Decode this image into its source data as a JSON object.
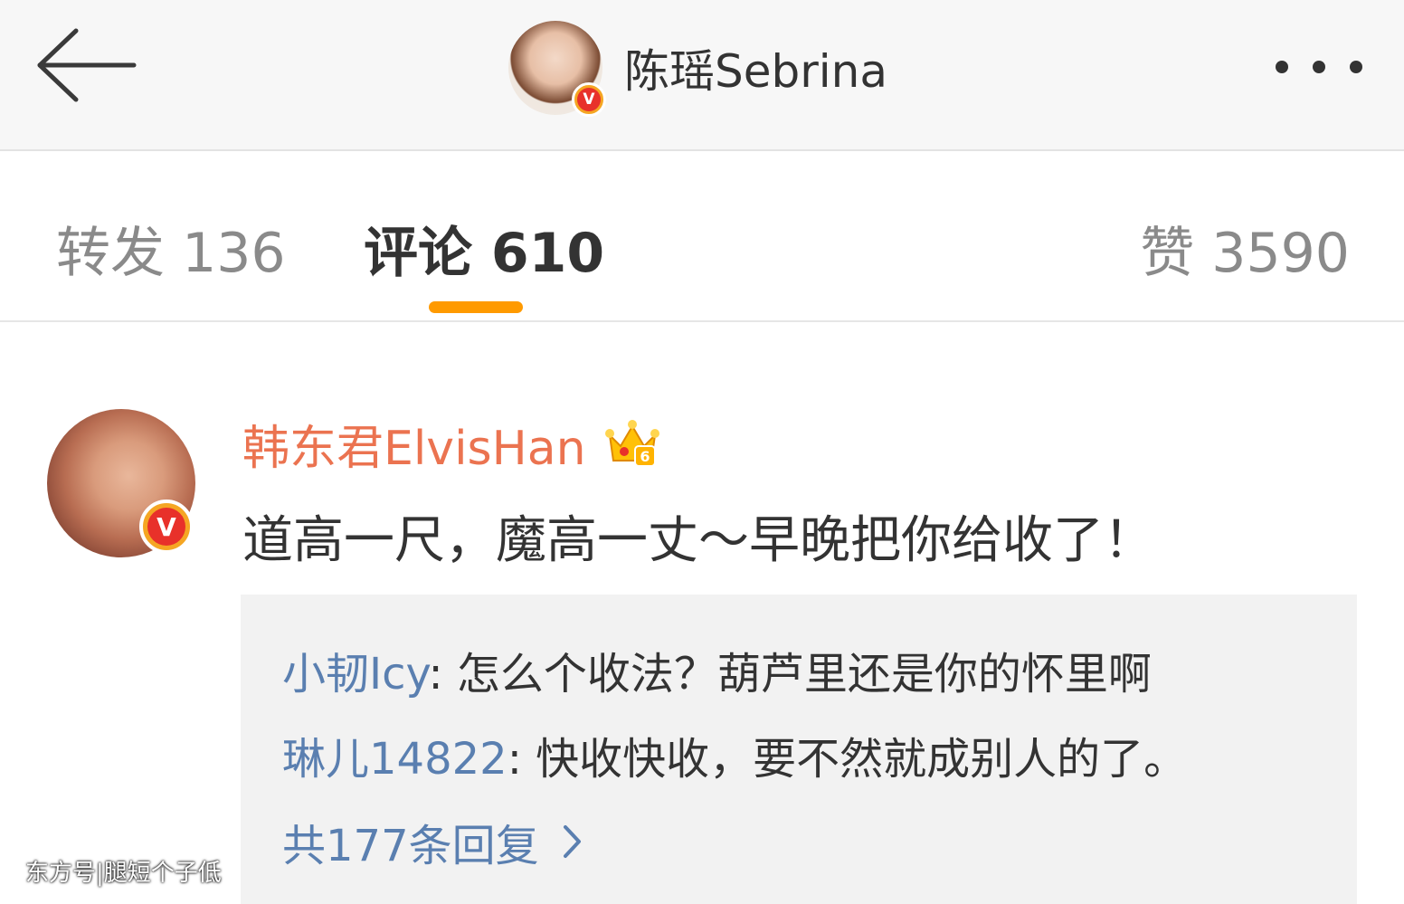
{
  "header": {
    "back_icon": "arrow-left-icon",
    "profile_name": "陈瑶Sebrina",
    "verified_badge": "V",
    "more_icon": "more-dots-icon"
  },
  "tabs": [
    {
      "label": "转发 136",
      "active": false
    },
    {
      "label": "评论 610",
      "active": true
    },
    {
      "label": "赞 3590",
      "active": false
    }
  ],
  "colors": {
    "accent": "#ff9a00",
    "username": "#eb7350",
    "reply_name": "#5a7fb0",
    "verified": "#e8312a"
  },
  "comment": {
    "username": "韩东君ElvisHan",
    "verified_badge": "V",
    "level_icon": "crown-icon",
    "level_number": "6",
    "text": "道高一尺，魔高一丈～早晚把你给收了！"
  },
  "replies": [
    {
      "name": "小韧Icy",
      "text": ": 怎么个收法？葫芦里还是你的怀里啊"
    },
    {
      "name": "琳儿14822",
      "text": ": 快收快收，要不然就成别人的了。"
    }
  ],
  "more_replies": "共177条回复",
  "watermark": "东方号|腿短个子低"
}
